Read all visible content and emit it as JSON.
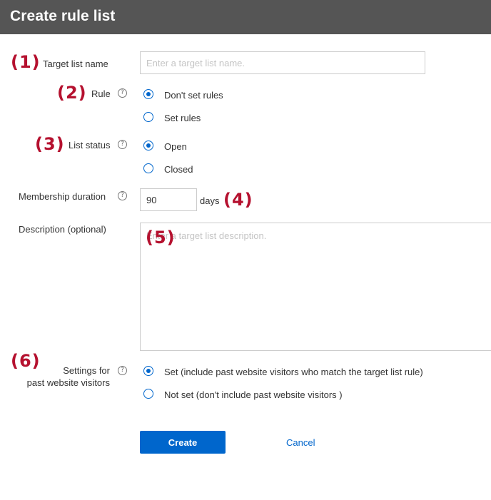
{
  "header": {
    "title": "Create rule list"
  },
  "markers": [
    "(1)",
    "(2)",
    "(3)",
    "(4)",
    "(5)",
    "(6)"
  ],
  "form": {
    "target_list_name": {
      "label": "Target list name",
      "placeholder": "Enter a target list name.",
      "value": ""
    },
    "rule": {
      "label": "Rule",
      "help": "?",
      "options": [
        "Don't set rules",
        "Set rules"
      ],
      "selected": "Don't set rules"
    },
    "list_status": {
      "label": "List status",
      "help": "?",
      "options": [
        "Open",
        "Closed"
      ],
      "selected": "Open"
    },
    "membership_duration": {
      "label": "Membership duration",
      "help": "?",
      "value": "90",
      "unit": "days"
    },
    "description": {
      "label": "Description (optional)",
      "placeholder": "Enter a target list description.",
      "value": ""
    },
    "past_visitors": {
      "label_line1": "Settings for",
      "label_line2": "past website visitors",
      "help": "?",
      "options": [
        "Set (include past website visitors who match the target list rule)",
        "Not set (don't include past website visitors )"
      ],
      "selected": "Set (include past website visitors who match the target list rule)"
    }
  },
  "actions": {
    "create": "Create",
    "cancel": "Cancel"
  },
  "colors": {
    "header_bg": "#555555",
    "accent": "#0066cc",
    "marker": "#b5112f"
  }
}
